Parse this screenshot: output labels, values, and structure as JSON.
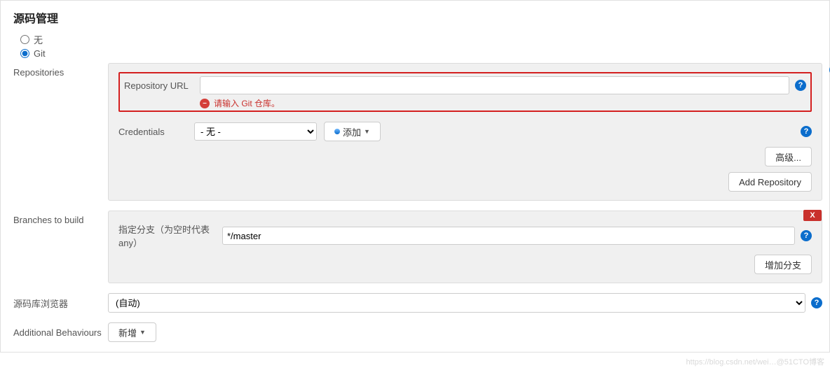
{
  "section_title": "源码管理",
  "scm": {
    "none_label": "无",
    "git_label": "Git",
    "selected": "git"
  },
  "repositories": {
    "label": "Repositories",
    "url_label": "Repository URL",
    "url_value": "",
    "error_msg": "请输入 Git 仓库。",
    "credentials_label": "Credentials",
    "credentials_selected": "- 无 -",
    "add_btn": "添加",
    "advanced_btn": "高级...",
    "add_repo_btn": "Add Repository"
  },
  "branches": {
    "label": "Branches to build",
    "spec_label": "指定分支（为空时代表any）",
    "spec_value": "*/master",
    "add_branch_btn": "增加分支",
    "delete_label": "X"
  },
  "browser": {
    "label": "源码库浏览器",
    "selected": "(自动)"
  },
  "additional": {
    "label": "Additional Behaviours",
    "add_btn": "新增"
  },
  "help_glyph": "?",
  "watermark": "https://blog.csdn.net/wei…@51CTO博客"
}
